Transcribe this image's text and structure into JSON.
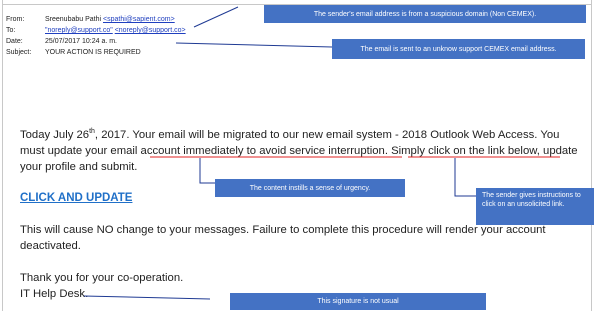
{
  "header": {
    "from_key": "From:",
    "from_name": "Sreenubabu Pathi",
    "from_email": "<spathi@sapient.com>",
    "to_key": "To:",
    "to_email_quoted": "\"noreply@support.co\"",
    "to_email": "<noreply@support.co>",
    "date_key": "Date:",
    "date_value": "25/07/2017 10:24 a. m.",
    "subject_key": "Subject:",
    "subject_value": "YOUR ACTION IS REQUIRED"
  },
  "body": {
    "p1_a": "Today July 26",
    "p1_sup": "th",
    "p1_b": ", 2017. Your email will be migrated to our new email system - 2018 Outlook Web Access. You must update your email account immediately to avoid service interruption. Simply click on the link below, update your profile and submit.",
    "cta": "CLICK AND UPDATE",
    "p2": "This will cause NO change to your messages. Failure to complete this procedure will render your account deactivated.",
    "p3_line1": "Thank you for your co-operation.",
    "p3_line2": "IT Help Desk."
  },
  "callouts": {
    "c1": "The sender's email address is from a suspicious domain (Non CEMEX).",
    "c2": "The email is sent to an unknow support CEMEX email address.",
    "c3": "The content instills a sense of urgency.",
    "c4": "The sender gives instructions to click on an unsolicited link.",
    "c5": "This signature is not usual"
  },
  "colors": {
    "callout_bg": "#4472c4",
    "annotation_line": "#1f3a93",
    "underline_red": "#e02020",
    "link_blue": "#2070c8"
  }
}
